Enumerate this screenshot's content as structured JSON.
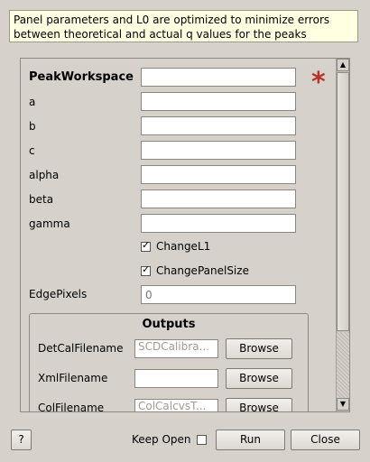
{
  "description": "Panel parameters and L0 are optimized to minimize errors between theoretical and actual q values for the peaks",
  "fields": [
    {
      "label": "PeakWorkspace",
      "value": "",
      "required": true
    },
    {
      "label": "a",
      "value": ""
    },
    {
      "label": "b",
      "value": ""
    },
    {
      "label": "c",
      "value": ""
    },
    {
      "label": "alpha",
      "value": ""
    },
    {
      "label": "beta",
      "value": ""
    },
    {
      "label": "gamma",
      "value": ""
    }
  ],
  "required_marker": "*",
  "checkboxes": [
    {
      "label": "ChangeL1",
      "checked": true
    },
    {
      "label": "ChangePanelSize",
      "checked": true
    }
  ],
  "check_glyph": "✓",
  "edge_pixels": {
    "label": "EdgePixels",
    "placeholder": "0"
  },
  "outputs": {
    "title": "Outputs",
    "rows": [
      {
        "label": "DetCalFilename",
        "placeholder": "SCDCalibra...",
        "button": "Browse"
      },
      {
        "label": "XmlFilename",
        "placeholder": "",
        "button": "Browse"
      },
      {
        "label": "ColFilename",
        "placeholder": "ColCalcvsT...",
        "button": "Browse"
      }
    ]
  },
  "scroll": {
    "up_arrow": "▲",
    "down_arrow": "▼"
  },
  "footer": {
    "help": "?",
    "keep_open": "Keep Open",
    "keep_open_checked": false,
    "run": "Run",
    "close": "Close"
  },
  "colors": {
    "required_star": "#b5352a",
    "description_bg": "#ffffe1",
    "window_bg": "#d6d2cb"
  }
}
